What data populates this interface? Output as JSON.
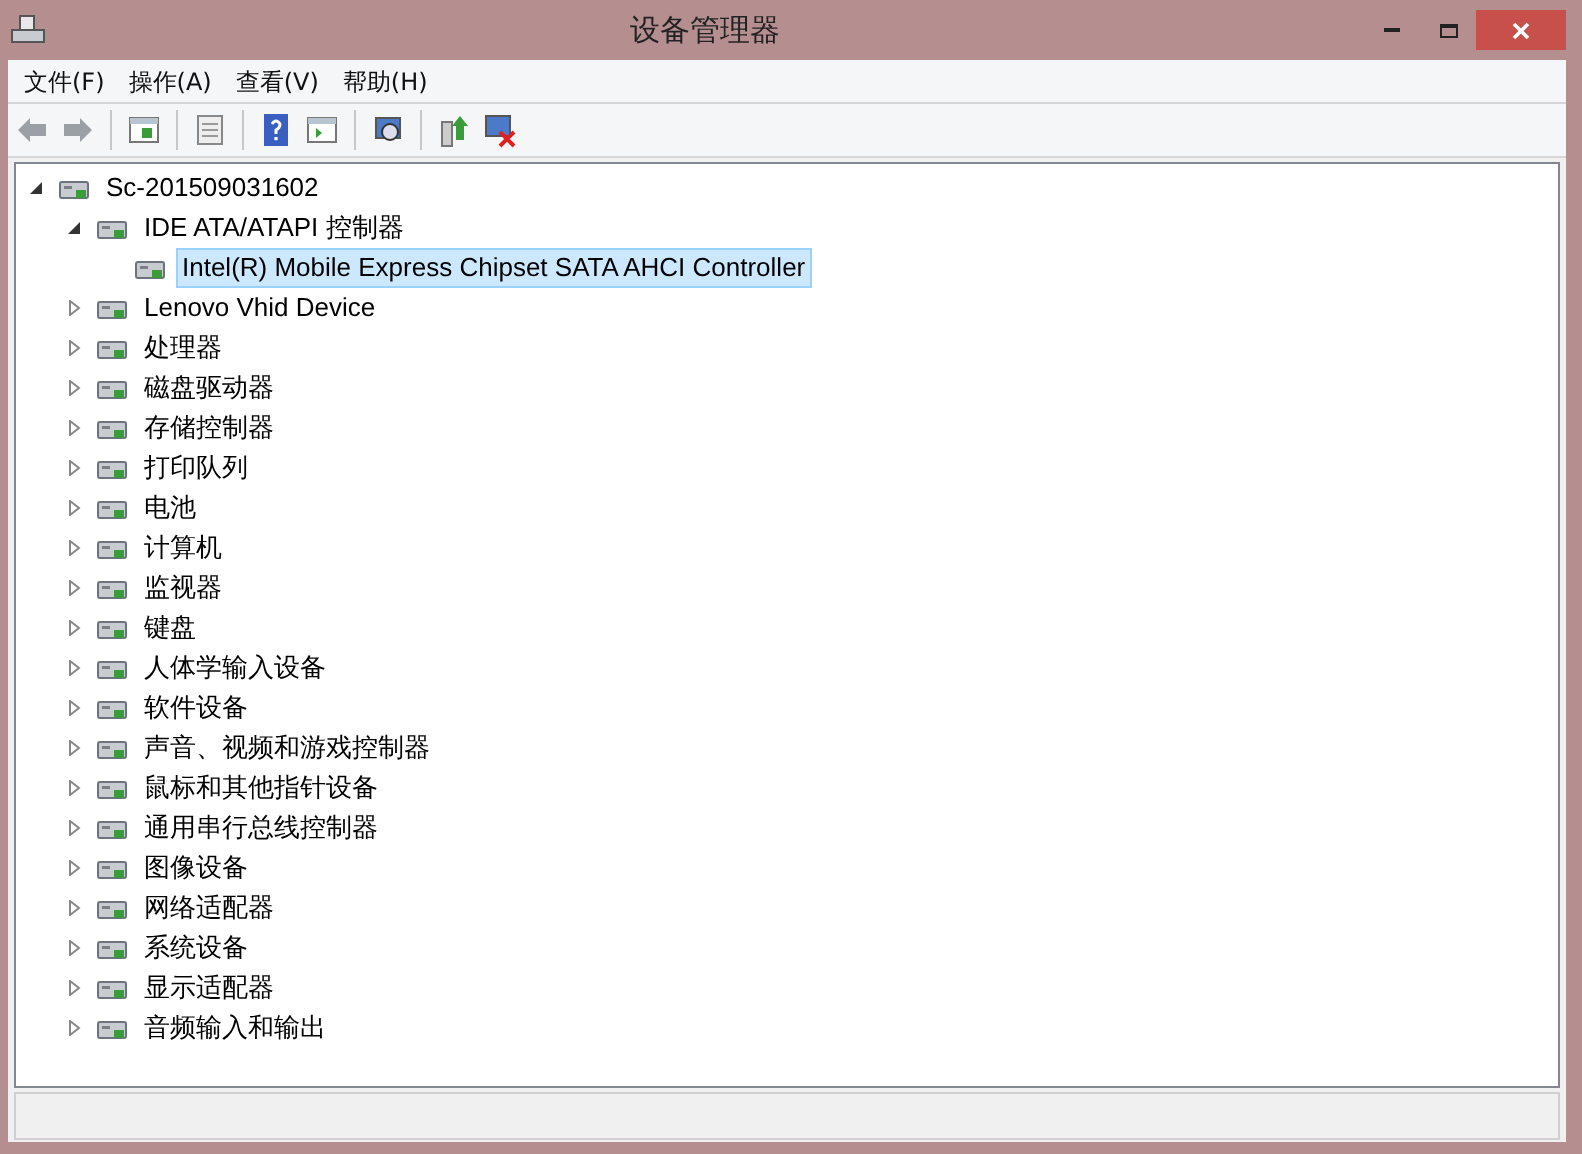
{
  "window": {
    "title": "设备管理器"
  },
  "menu": [
    "文件(F)",
    "操作(A)",
    "查看(V)",
    "帮助(H)"
  ],
  "tree": {
    "label": "Sc-201509031602",
    "expanded": true,
    "selected": false,
    "children": [
      {
        "label": "IDE ATA/ATAPI 控制器",
        "expanded": true,
        "selected": false,
        "children": [
          {
            "label": "Intel(R) Mobile Express Chipset SATA AHCI Controller",
            "selected": true
          }
        ]
      },
      {
        "label": "Lenovo Vhid Device",
        "expanded": false,
        "selected": false
      },
      {
        "label": "处理器",
        "expanded": false,
        "selected": false
      },
      {
        "label": "磁盘驱动器",
        "expanded": false,
        "selected": false
      },
      {
        "label": "存储控制器",
        "expanded": false,
        "selected": false
      },
      {
        "label": "打印队列",
        "expanded": false,
        "selected": false
      },
      {
        "label": "电池",
        "expanded": false,
        "selected": false
      },
      {
        "label": "计算机",
        "expanded": false,
        "selected": false
      },
      {
        "label": "监视器",
        "expanded": false,
        "selected": false
      },
      {
        "label": "键盘",
        "expanded": false,
        "selected": false
      },
      {
        "label": "人体学输入设备",
        "expanded": false,
        "selected": false
      },
      {
        "label": "软件设备",
        "expanded": false,
        "selected": false
      },
      {
        "label": "声音、视频和游戏控制器",
        "expanded": false,
        "selected": false
      },
      {
        "label": "鼠标和其他指针设备",
        "expanded": false,
        "selected": false
      },
      {
        "label": "通用串行总线控制器",
        "expanded": false,
        "selected": false
      },
      {
        "label": "图像设备",
        "expanded": false,
        "selected": false
      },
      {
        "label": "网络适配器",
        "expanded": false,
        "selected": false
      },
      {
        "label": "系统设备",
        "expanded": false,
        "selected": false
      },
      {
        "label": "显示适配器",
        "expanded": false,
        "selected": false
      },
      {
        "label": "音频输入和输出",
        "expanded": false,
        "selected": false
      }
    ]
  }
}
